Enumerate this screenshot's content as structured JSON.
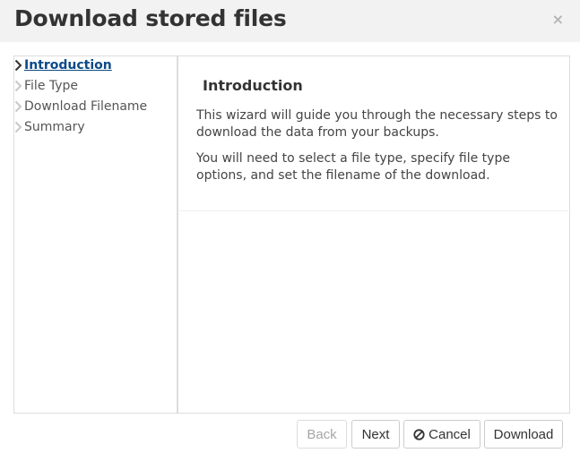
{
  "dialog": {
    "title": "Download stored files",
    "close_label": "×"
  },
  "steps": [
    {
      "label": "Introduction",
      "active": true
    },
    {
      "label": "File Type",
      "active": false
    },
    {
      "label": "Download Filename",
      "active": false
    },
    {
      "label": "Summary",
      "active": false
    }
  ],
  "content": {
    "heading": "Introduction",
    "paragraph1": "This wizard will guide you through the necessary steps to download the data from your backups.",
    "paragraph2": "You will need to select a file type, specify file type options, and set the filename of the download."
  },
  "buttons": {
    "back": "Back",
    "next": "Next",
    "cancel": "Cancel",
    "download": "Download"
  },
  "colors": {
    "active_step": "#0c4a87",
    "titlebar_bg": "#f2f2f2",
    "border": "#dddddd"
  }
}
